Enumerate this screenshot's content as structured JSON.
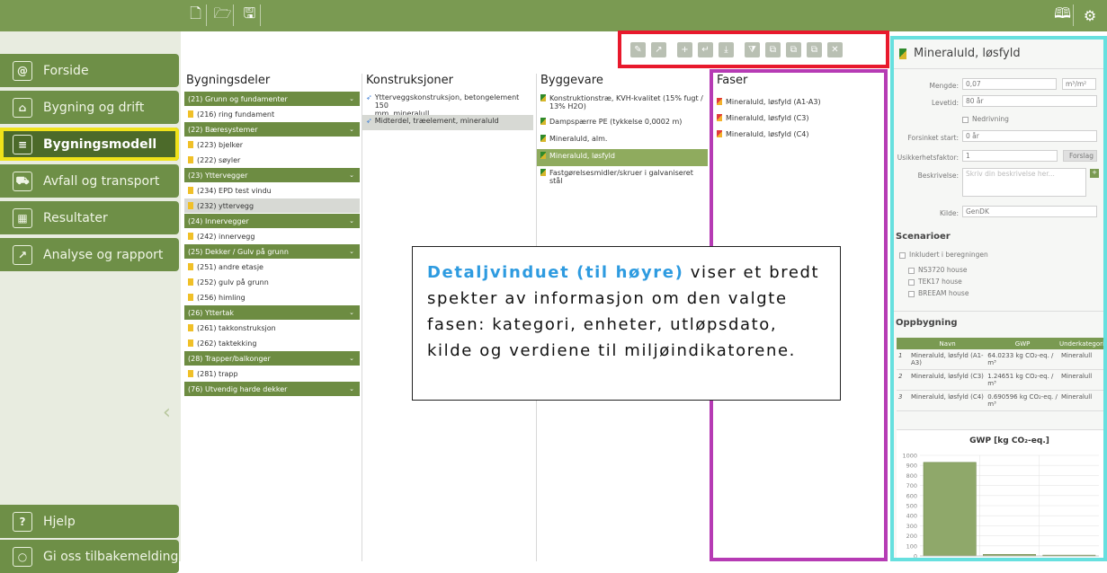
{
  "sidebar": {
    "items": [
      {
        "label": "Forside",
        "icon": "home-icon",
        "glyph": "@"
      },
      {
        "label": "Bygning og drift",
        "icon": "house-icon",
        "glyph": "⌂"
      },
      {
        "label": "Bygningsmodell",
        "icon": "document-icon",
        "glyph": "≡",
        "active": true
      },
      {
        "label": "Avfall og transport",
        "icon": "truck-icon",
        "glyph": "⛟"
      },
      {
        "label": "Resultater",
        "icon": "table-icon",
        "glyph": "▦"
      },
      {
        "label": "Analyse og rapport",
        "icon": "chart-icon",
        "glyph": "↗"
      }
    ],
    "help": "Hjelp",
    "feedback": "Gi oss tilbakemelding"
  },
  "columns": {
    "bygningsdeler": "Bygningsdeler",
    "konstruksjoner": "Konstruksjoner",
    "byggevare": "Byggevare",
    "faser": "Faser"
  },
  "bygningsdeler": [
    {
      "t": "(21) Grunn og fundamenter",
      "g": true
    },
    {
      "t": "(216) ring fundament"
    },
    {
      "t": "(22) Bæresystemer",
      "g": true
    },
    {
      "t": "(223) bjelker"
    },
    {
      "t": "(222) søyler"
    },
    {
      "t": "(23) Yttervegger",
      "g": true
    },
    {
      "t": "(234) EPD test vindu"
    },
    {
      "t": "(232) yttervegg",
      "s": true
    },
    {
      "t": "(24) Innervegger",
      "g": true
    },
    {
      "t": "(242) innervegg"
    },
    {
      "t": "(25) Dekker / Gulv på grunn",
      "g": true
    },
    {
      "t": "(251) andre etasje"
    },
    {
      "t": "(252) gulv på grunn"
    },
    {
      "t": "(256) himling"
    },
    {
      "t": "(26) Yttertak",
      "g": true
    },
    {
      "t": "(261) takkonstruksjon"
    },
    {
      "t": "(262) taktekking"
    },
    {
      "t": "(28) Trapper/balkonger",
      "g": true
    },
    {
      "t": "(281) trapp"
    },
    {
      "t": "(76) Utvendig harde dekker",
      "g": true
    }
  ],
  "konstruksjoner": [
    {
      "t1": "Ytterveggskonstruksjon, betongelement 150",
      "t2": "mm, mineralull"
    },
    {
      "t1": "Midterdel, træelement, mineraluld",
      "t2": "",
      "s": true
    }
  ],
  "byggevare": [
    {
      "t1": "Konstruktionstræ, KVH-kvalitet (15% fugt /",
      "t2": "13% H2O)"
    },
    {
      "t1": "Dampspærre PE (tykkelse 0,0002 m)",
      "t2": ""
    },
    {
      "t1": "Mineraluld, alm.",
      "t2": ""
    },
    {
      "t1": "Mineraluld, løsfyld",
      "t2": "",
      "s": true
    },
    {
      "t1": "Fastgørelsesmidler/skruer i galvaniseret stål",
      "t2": ""
    }
  ],
  "faser": [
    "Mineraluld, løsfyld (A1-A3)",
    "Mineraluld, løsfyld (C3)",
    "Mineraluld, løsfyld (C4)"
  ],
  "detail": {
    "title": "Mineraluld, løsfyld",
    "mengde_label": "Mengde:",
    "mengde": "0,07",
    "unit": "m³/m²",
    "levetid_label": "Levetid:",
    "levetid": "80 år",
    "nedrivning": "Nedrivning",
    "forsinket_label": "Forsinket start:",
    "forsinket": "0 år",
    "usikker_label": "Usikkerhetsfaktor:",
    "usikker": "1",
    "forslag": "Forslag",
    "beskrivelse_label": "Beskrivelse:",
    "beskrivelse_ph": "Skriv din beskrivelse her...",
    "kilde_label": "Kilde:",
    "kilde": "GenDK",
    "scenarioer": "Scenarioer",
    "inkludert": "Inkludert i beregningen",
    "scenarios": [
      "NS3720 house",
      "TEK17 house",
      "BREEAM house"
    ],
    "oppbygning": "Oppbygning",
    "table_headers": [
      "Navn",
      "GWP",
      "Underkategori"
    ],
    "table_rows": [
      {
        "n": "1",
        "navn": "Mineraluld, løsfyld (A1-A3)",
        "gwp": "64.0233 kg CO₂-eq. / m³",
        "kat": "Mineralull"
      },
      {
        "n": "2",
        "navn": "Mineraluld, løsfyld (C3)",
        "gwp": "1.24651 kg CO₂-eq. / m³",
        "kat": "Mineralull"
      },
      {
        "n": "3",
        "navn": "Mineraluld, løsfyld (C4)",
        "gwp": "0.690596 kg CO₂-eq. / m³",
        "kat": "Mineralull"
      }
    ]
  },
  "tooltip": {
    "highlight": "Detaljvinduet (til høyre)",
    "text": " viser et bredt spekter av informasjon om den valgte fasen: kategori, enheter, utløpsdato, kilde og verdiene til miljøindikatorene."
  },
  "chart_data": {
    "type": "bar",
    "title": "GWP [kg CO₂-eq.]",
    "categories": [
      "1",
      "2",
      "3"
    ],
    "values": [
      930,
      15,
      8
    ],
    "ylim": [
      0,
      1000
    ],
    "yticks": [
      0,
      100,
      200,
      300,
      400,
      500,
      600,
      700,
      800,
      900,
      1000
    ],
    "color": "#8fa86a"
  }
}
